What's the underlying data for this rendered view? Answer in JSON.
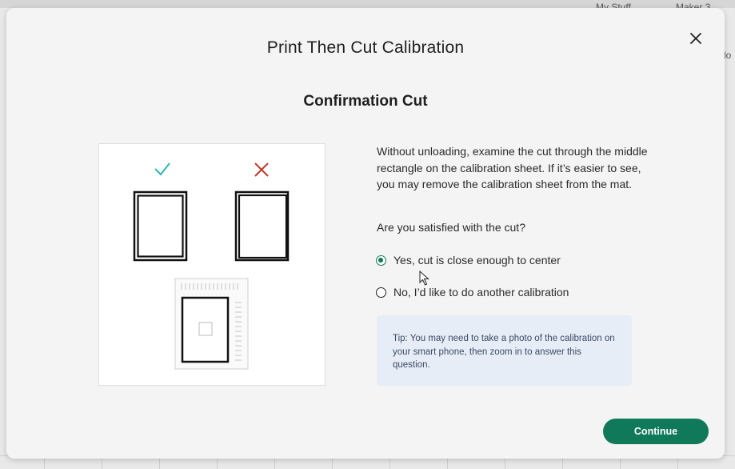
{
  "background": {
    "top_items": [
      "My Stuff",
      "Maker 3"
    ],
    "side_fragment": "lo"
  },
  "modal": {
    "title": "Print Then Cut Calibration",
    "subtitle": "Confirmation Cut",
    "close_icon": "close-icon",
    "illustration": {
      "good_icon": "check-icon",
      "bad_icon": "x-icon",
      "good_color": "#2bb7b3",
      "bad_color": "#c0392b"
    },
    "description": "Without unloading, examine the cut through the middle rectangle on the calibration sheet. If it’s easier to see, you may remove the calibration sheet from the mat.",
    "question": "Are you satisfied with the cut?",
    "options": [
      {
        "label": "Yes, cut is close enough to center",
        "selected": true
      },
      {
        "label": "No, I’d like to do another calibration",
        "selected": false
      }
    ],
    "tip": "Tip: You may need to take a photo of the calibration on your smart phone, then zoom in to answer this question.",
    "continue_label": "Continue",
    "accent_color": "#10795a"
  }
}
